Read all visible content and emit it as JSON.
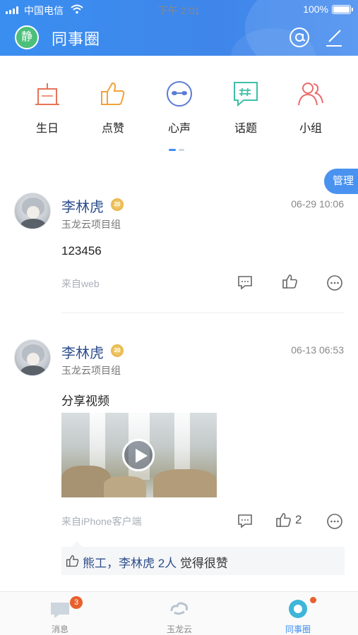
{
  "status_bar": {
    "carrier": "中国电信",
    "time": "下午 2:01",
    "battery": "100%"
  },
  "header": {
    "avatar_text": "静",
    "title": "同事圈"
  },
  "categories": [
    {
      "label": "生日",
      "icon": "birthday-cake-icon"
    },
    {
      "label": "点赞",
      "icon": "thumbs-up-icon"
    },
    {
      "label": "心声",
      "icon": "mask-icon"
    },
    {
      "label": "话题",
      "icon": "topic-hash-icon"
    },
    {
      "label": "小组",
      "icon": "group-icon"
    }
  ],
  "manage_label": "管理",
  "posts": [
    {
      "author": "李林虎",
      "medal": "20",
      "time": "06-29 10:06",
      "group": "玉龙云项目组",
      "content": "123456",
      "source": "来自web",
      "like_count": ""
    },
    {
      "author": "李林虎",
      "medal": "20",
      "time": "06-13 06:53",
      "group": "玉龙云项目组",
      "content": "分享视频",
      "source": "来自iPhone客户端",
      "like_count": "2",
      "likers": "熊工，李林虎 2人",
      "likers_suffix": "觉得很赞"
    }
  ],
  "tabbar": {
    "items": [
      {
        "label": "消息",
        "badge": "3",
        "icon": "message-icon"
      },
      {
        "label": "玉龙云",
        "icon": "cloud-logo-icon"
      },
      {
        "label": "同事圈",
        "icon": "moments-icon",
        "active": true
      }
    ]
  },
  "colors": {
    "header": "#3e8ef7",
    "accent": "#3e8ef7",
    "name": "#2e4f8c",
    "badge": "#e8602d"
  }
}
